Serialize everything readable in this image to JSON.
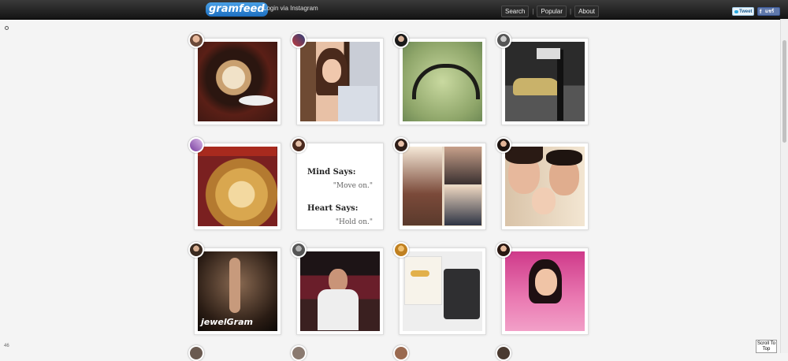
{
  "header": {
    "logo": "gramfeed",
    "tagline": "- Login via Instagram",
    "nav": [
      "Search",
      "Popular",
      "About"
    ],
    "tweet_label": "Tweet",
    "share_label": "แชร์"
  },
  "quote": {
    "line1": "Mind Says:",
    "line2": "\"Move on.\"",
    "line3": "Heart Says:",
    "line4": "\"Hold on.\""
  },
  "watermark": "jewelGram",
  "photo_count": "46",
  "scroll_top_label": "Scroll To Top"
}
